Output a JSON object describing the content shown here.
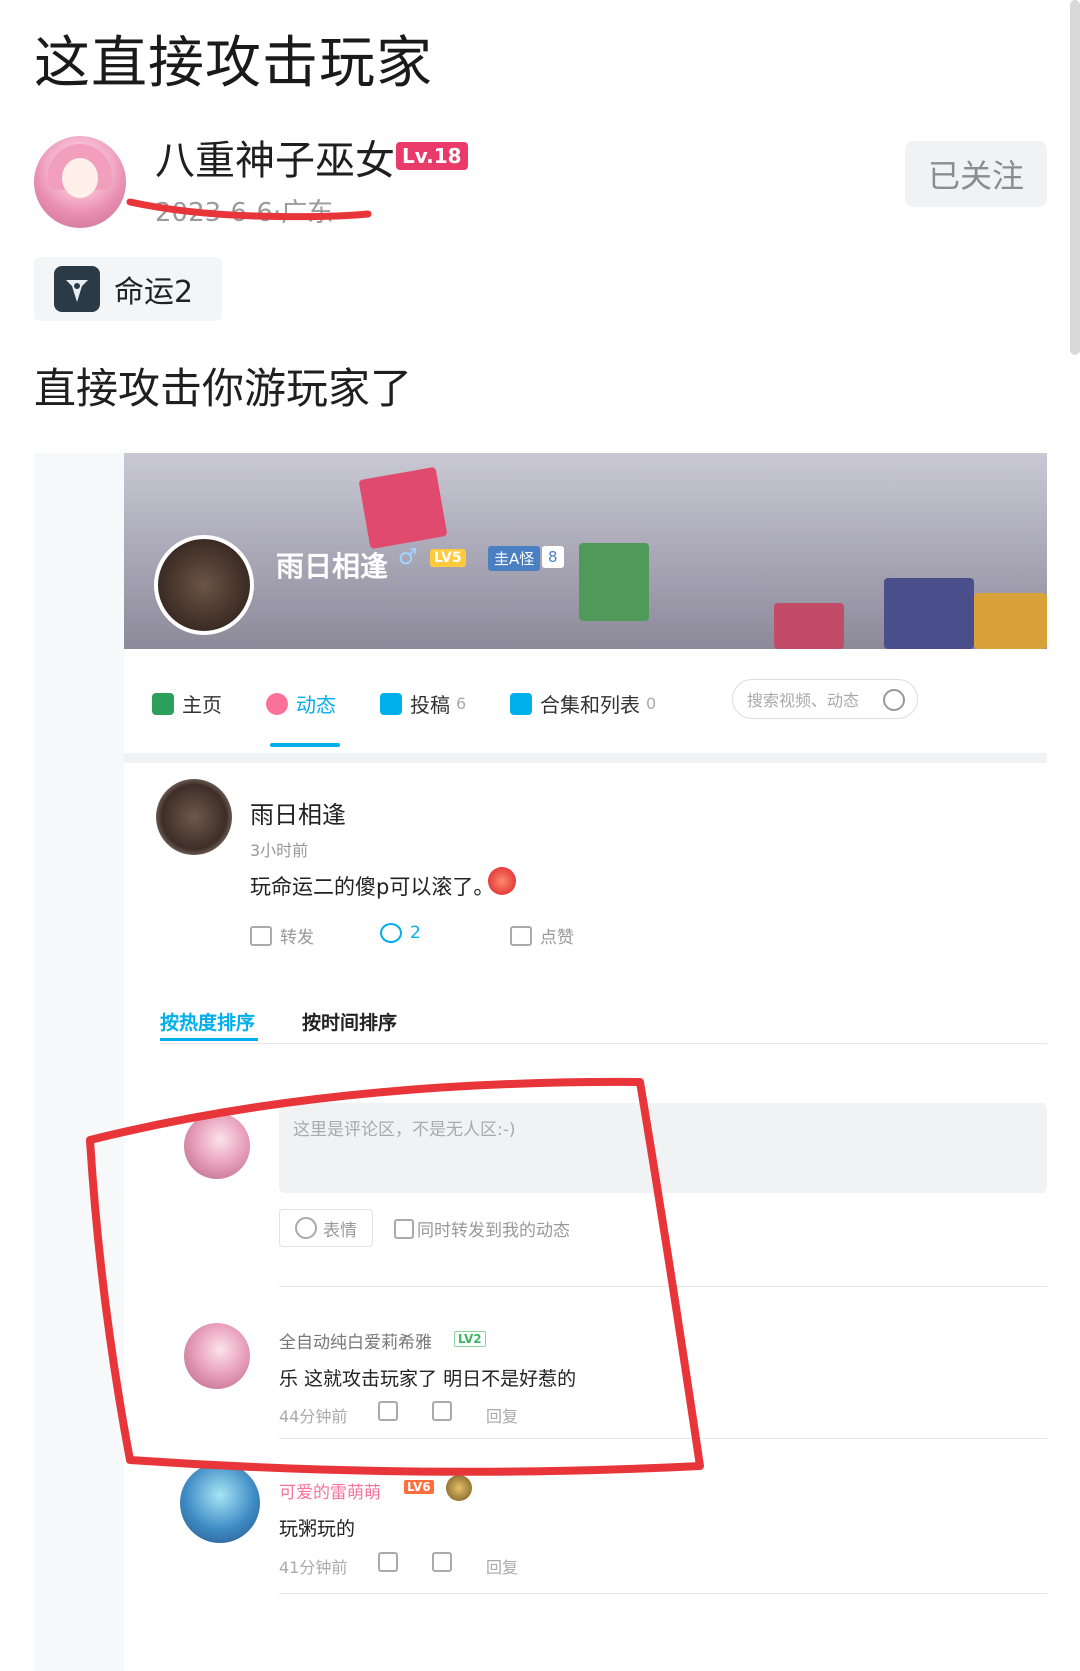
{
  "post": {
    "title": "这直接攻击玩家",
    "author": "八重神子巫女",
    "level": "Lv.18",
    "meta": "2023-6-6·广东",
    "follow_label": "已关注",
    "tag_label": "命运2",
    "body": "直接攻击你游玩家了"
  },
  "screenshot": {
    "banner": {
      "username": "雨日相逢",
      "gender": "♂",
      "level": "LV5",
      "badge": "圭A怪",
      "badge_count": "8"
    },
    "nav": {
      "home": "主页",
      "dynamic": "动态",
      "posts": "投稿",
      "posts_count": "6",
      "collections": "合集和列表",
      "collections_count": "0",
      "search_placeholder": "搜索视频、动态"
    },
    "dynamic_post": {
      "name": "雨日相逢",
      "time": "3小时前",
      "text": "玩命运二的傻p可以滚了。",
      "forward": "转发",
      "comments": "2",
      "like": "点赞"
    },
    "sort": {
      "hot": "按热度排序",
      "time": "按时间排序"
    },
    "comment_box": {
      "placeholder": "这里是评论区，不是无人区:-)",
      "emoji_label": "表情",
      "forward_label": "同时转发到我的动态"
    },
    "comments": [
      {
        "name": "全自动纯白爱莉希雅",
        "level": "LV2",
        "text": "乐 这就攻击玩家了 明日不是好惹的",
        "time": "44分钟前",
        "reply": "回复"
      },
      {
        "name": "可爱的雷萌萌",
        "level": "LV6",
        "text": "玩粥玩的",
        "time": "41分钟前",
        "reply": "回复"
      }
    ]
  },
  "colors": {
    "accent": "#00aeec",
    "pink": "#fb7299",
    "level_badge": "#e93a6a",
    "annotation_red": "#e8353a"
  }
}
